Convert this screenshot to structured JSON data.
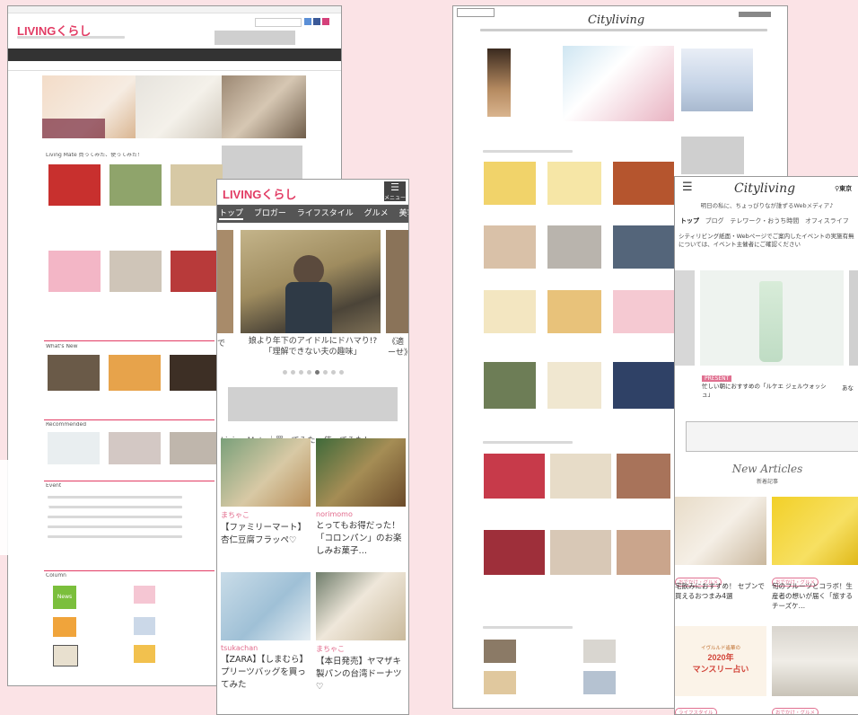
{
  "living": {
    "logo": "LIVINGくらし",
    "living_mate_heading": "Living Mate 買ってみた、使ってみた！",
    "whats_new_heading": "What's New",
    "recommended_heading": "Recommended",
    "event_heading": "Event",
    "column_heading": "Column",
    "news_badge": "News"
  },
  "living_mobile": {
    "logo": "LIVINGくらし",
    "menu_label": "メニュー",
    "tabs": [
      "トップ",
      "ブロガー",
      "ライフスタイル",
      "グルメ",
      "美容・健康"
    ],
    "slide_caption_line1": "娘より年下のアイドルにドハマり!?",
    "slide_caption_line2": "「理解できない夫の趣味」",
    "next_slide_text_line1": "《適",
    "next_slide_text_line2": "ーせ》",
    "prev_slide_text": "で",
    "section_title": "Living Mate｜買ってみた、使ってみた！",
    "cards": [
      {
        "author": "まちゃこ",
        "title": "【ファミリーマート】杏仁豆腐フラッペ♡"
      },
      {
        "author": "norimomo",
        "title": "とってもお得だった！「コロンパン」のお楽しみお菓子…"
      },
      {
        "author": "tsukachan",
        "title": "【ZARA】【しまむら】プリーツバッグを買ってみた"
      },
      {
        "author": "まちゃこ",
        "title": "【本日発売】ヤマザキ製パンの台湾ドーナツ♡"
      }
    ]
  },
  "city": {
    "logo": "Cityliving"
  },
  "city_mobile": {
    "logo": "Cityliving",
    "location": "東京",
    "tagline": "明日の私に、ちょっぴりなが誰ずるWebメディア♪",
    "tabs_active": "トップ",
    "tabs": [
      "ブログ",
      "テレワーク・おうち時間",
      "オフィスライフ"
    ],
    "notice": "シティリビング紙面・Webページでご案内したイベントの実施有無については、イベント主催者にご確認ください",
    "present_label": "PRESENT",
    "present_caption": "忙しい朝におすすめの「ルケエ ジェルウォッシュ」",
    "present_caption_right": "あな",
    "new_articles": "New Articles",
    "new_articles_sub": "新着記事",
    "articles": [
      {
        "tag": "おでかけ・グルメ",
        "title": "宅飲みにおすすめ！ セブンで買えるおつまみ4選"
      },
      {
        "tag": "おでかけ・グルメ",
        "title": "旬のフルーツとコラボ！生産者の想いが届く「旅するチーズケ…"
      },
      {
        "tag": "ライフスタイル",
        "banner_year": "2020年",
        "banner_text": "マンスリー占い",
        "banner_top": "イヴルルド遙華の"
      },
      {
        "tag": "おでかけ・グルメ"
      }
    ]
  },
  "colors": {
    "background": "#fbe3e6",
    "living_pink": "#e23c64",
    "nav_dark": "#333333",
    "tab_gray": "#555555"
  }
}
